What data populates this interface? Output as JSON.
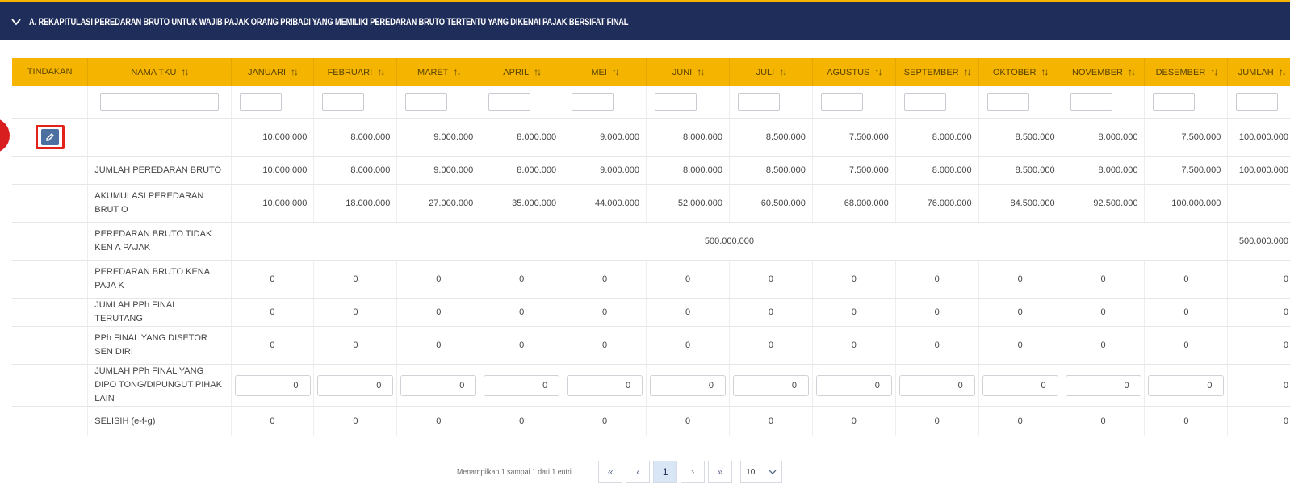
{
  "section": {
    "title": "A. REKAPITULASI PEREDARAN BRUTO UNTUK WAJIB PAJAK ORANG PRIBADI YANG MEMILIKI PEREDARAN BRUTO TERTENTU YANG DIKENAI PAJAK BERSIFAT FINAL",
    "icon": "chevron-down-icon"
  },
  "colors": {
    "header_bg": "#1f2d5a",
    "accent": "#f4b400",
    "table_header": "#f4b400",
    "highlight": "#e2231a"
  },
  "table": {
    "headers": {
      "action": "TINDAKAN",
      "name": "NAMA TKU",
      "months": [
        "JANUARI",
        "FEBRUARI",
        "MARET",
        "APRIL",
        "MEI",
        "JUNI",
        "JULI",
        "AGUSTUS",
        "SEPTEMBER",
        "OKTOBER",
        "NOVEMBER",
        "DESEMBER",
        "JUMLAH"
      ]
    },
    "sort_glyph": "↑↓",
    "data_row": {
      "name": "",
      "values": [
        "10.000.000",
        "8.000.000",
        "9.000.000",
        "8.000.000",
        "9.000.000",
        "8.000.000",
        "8.500.000",
        "7.500.000",
        "8.000.000",
        "8.500.000",
        "8.000.000",
        "7.500.000",
        "100.000.000"
      ]
    },
    "rows": {
      "jumlah_peredaran": {
        "label": "JUMLAH PEREDARAN BRUTO",
        "values": [
          "10.000.000",
          "8.000.000",
          "9.000.000",
          "8.000.000",
          "9.000.000",
          "8.000.000",
          "8.500.000",
          "7.500.000",
          "8.000.000",
          "8.500.000",
          "8.000.000",
          "7.500.000",
          "100.000.000"
        ]
      },
      "akumulasi": {
        "label": "AKUMULASI PEREDARAN BRUT O",
        "values": [
          "10.000.000",
          "18.000.000",
          "27.000.000",
          "35.000.000",
          "44.000.000",
          "52.000.000",
          "60.500.000",
          "68.000.000",
          "76.000.000",
          "84.500.000",
          "92.500.000",
          "100.000.000",
          ""
        ]
      },
      "tidak_kena": {
        "label": "PEREDARAN BRUTO TIDAK KEN A PAJAK",
        "merged_value": "500.000.000",
        "total": "500.000.000"
      },
      "kena_pajak": {
        "label": "PEREDARAN BRUTO KENA PAJA K",
        "values": [
          "0",
          "0",
          "0",
          "0",
          "0",
          "0",
          "0",
          "0",
          "0",
          "0",
          "0",
          "0",
          "0"
        ]
      },
      "pph_terutang": {
        "label": "JUMLAH PPh FINAL TERUTANG",
        "values": [
          "0",
          "0",
          "0",
          "0",
          "0",
          "0",
          "0",
          "0",
          "0",
          "0",
          "0",
          "0",
          "0"
        ]
      },
      "pph_disetor": {
        "label": "PPh FINAL YANG DISETOR SEN DIRI",
        "values": [
          "0",
          "0",
          "0",
          "0",
          "0",
          "0",
          "0",
          "0",
          "0",
          "0",
          "0",
          "0",
          "0"
        ]
      },
      "pph_dipotong": {
        "label": "JUMLAH PPh FINAL YANG DIPO TONG/DIPUNGUT PIHAK LAIN",
        "values": [
          "0",
          "0",
          "0",
          "0",
          "0",
          "0",
          "0",
          "0",
          "0",
          "0",
          "0",
          "0",
          "0"
        ]
      },
      "selisih": {
        "label": "SELISIH (e-f-g)",
        "values": [
          "0",
          "0",
          "0",
          "0",
          "0",
          "0",
          "0",
          "0",
          "0",
          "0",
          "0",
          "0",
          "0"
        ]
      }
    }
  },
  "pagination": {
    "info": "Menampilkan 1 sampai 1 dari 1 entri",
    "first": "«",
    "prev": "‹",
    "current": "1",
    "next": "›",
    "last": "»",
    "page_size": "10"
  }
}
